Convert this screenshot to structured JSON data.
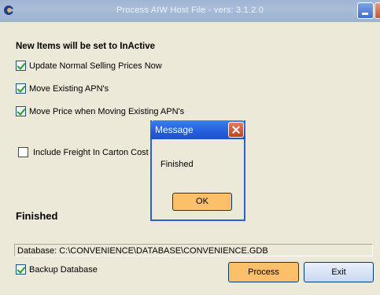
{
  "window": {
    "title": "Process AIW Host File - vers: 3.1.2.0"
  },
  "options": {
    "heading": "New Items will be set to InActive",
    "update_prices": {
      "label": "Update Normal Selling Prices Now",
      "checked": true
    },
    "move_apns": {
      "label": "Move Existing APN's",
      "checked": true
    },
    "move_price": {
      "label": "Move Price when Moving Existing APN's",
      "checked": true
    },
    "include_freight": {
      "label": "Include Freight In Carton Cost",
      "checked": false
    }
  },
  "status": "Finished",
  "database": "Database: C:\\CONVENIENCE\\DATABASE\\CONVENIENCE.GDB",
  "backup": {
    "label": "Backup Database",
    "checked": true
  },
  "buttons": {
    "process": "Process",
    "exit": "Exit"
  },
  "message": {
    "title": "Message",
    "text": "Finished",
    "ok": "OK"
  },
  "colors": {
    "accent": "#fcbf6a",
    "titlebar": "#245ddb"
  }
}
